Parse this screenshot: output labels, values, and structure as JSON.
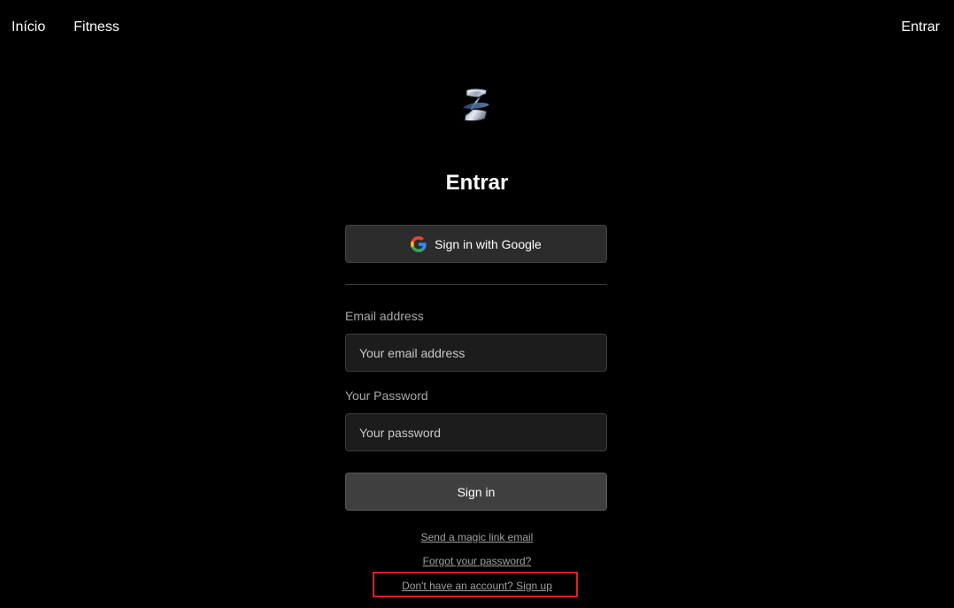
{
  "nav": {
    "home_label": "Início",
    "fitness_label": "Fitness",
    "signin_label": "Entrar"
  },
  "brand": {
    "logo_icon": "stylized-z-logo-icon"
  },
  "auth": {
    "title": "Entrar",
    "google_button_label": "Sign in with Google",
    "google_icon": "google-g-icon",
    "email_label": "Email address",
    "email_placeholder": "Your email address",
    "email_value": "",
    "password_label": "Your Password",
    "password_placeholder": "Your password",
    "password_value": "",
    "submit_label": "Sign in",
    "magic_link_label": "Send a magic link email",
    "forgot_password_label": "Forgot your password?",
    "signup_label": "Don't have an account? Sign up"
  },
  "colors": {
    "background": "#000000",
    "button_bg": "#2c2c2c",
    "input_bg": "#1c1c1c",
    "highlight": "#e02020"
  }
}
